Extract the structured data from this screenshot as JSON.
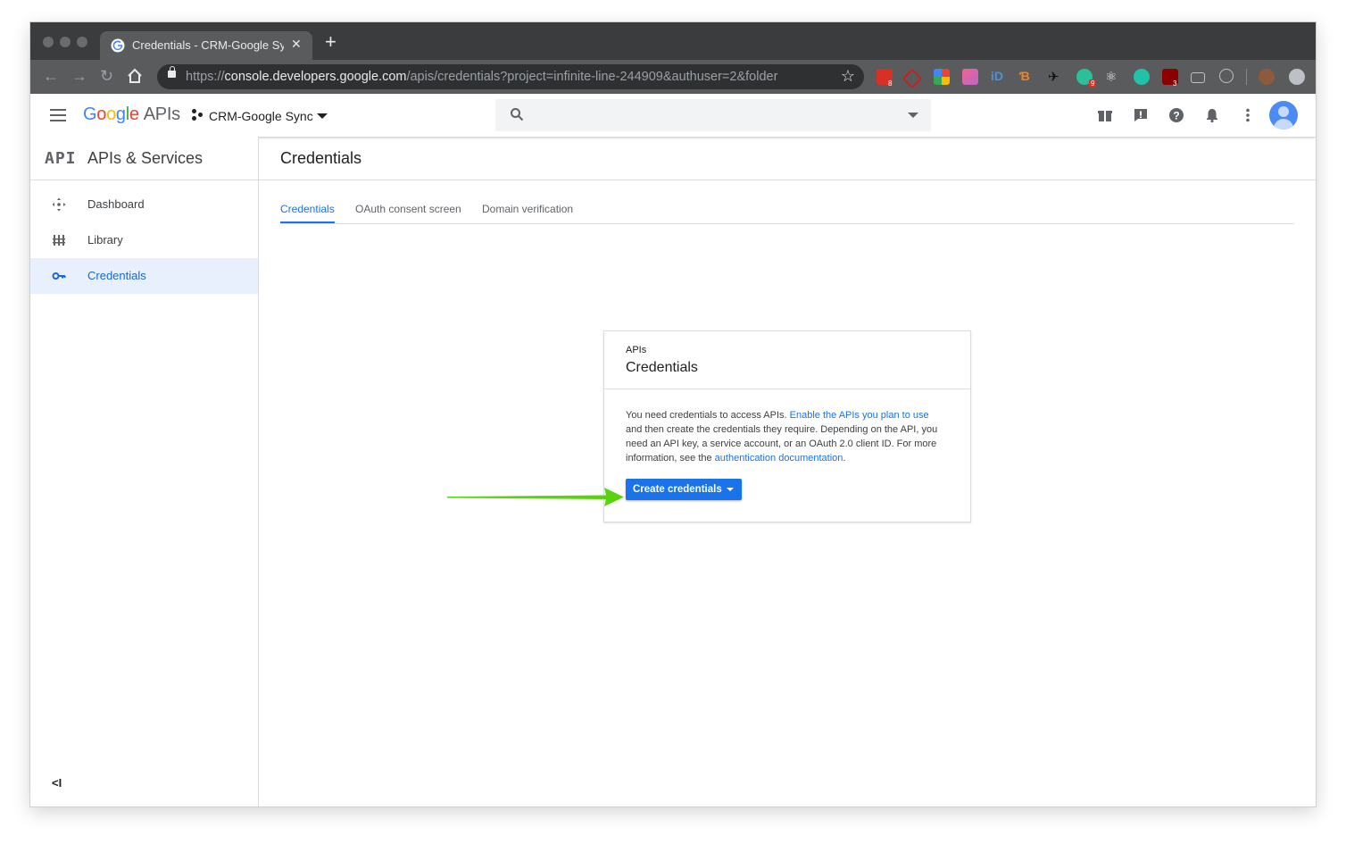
{
  "browser": {
    "tab_title": "Credentials - CRM-Google Sync",
    "tab_close_icon": "close-icon",
    "new_tab_label": "+",
    "url_scheme": "https://",
    "url_host": "console.developers.google.com",
    "url_path": "/apis/credentials?project=infinite-line-244909&authuser=2&folder",
    "extension_badges": [
      "8",
      "9",
      "3"
    ]
  },
  "header": {
    "logo_text": "Google",
    "logo_suffix": "APIs",
    "project_name": "CRM-Google Sync",
    "search_placeholder": ""
  },
  "sidebar": {
    "mark": "API",
    "title": "APIs & Services",
    "items": [
      {
        "label": "Dashboard",
        "icon": "dashboard-icon",
        "active": false
      },
      {
        "label": "Library",
        "icon": "library-icon",
        "active": false
      },
      {
        "label": "Credentials",
        "icon": "key-icon",
        "active": true
      }
    ],
    "collapse_label": "<I"
  },
  "main": {
    "title": "Credentials",
    "tabs": [
      {
        "label": "Credentials",
        "active": true
      },
      {
        "label": "OAuth consent screen",
        "active": false
      },
      {
        "label": "Domain verification",
        "active": false
      }
    ],
    "card": {
      "eyebrow": "APIs",
      "title": "Credentials",
      "body_1": "You need credentials to access APIs. ",
      "link_1": "Enable the APIs you plan to use",
      "body_2": " and then create the credentials they require. Depending on the API, you need an API key, a service account, or an OAuth 2.0 client ID. For more information, see the ",
      "link_2": "authentication documentation",
      "body_3": ".",
      "button_label": "Create credentials"
    }
  },
  "colors": {
    "accent": "#1a73e8",
    "annotation_arrow": "#5ad30f",
    "active_nav_bg": "#e8f0fe"
  }
}
